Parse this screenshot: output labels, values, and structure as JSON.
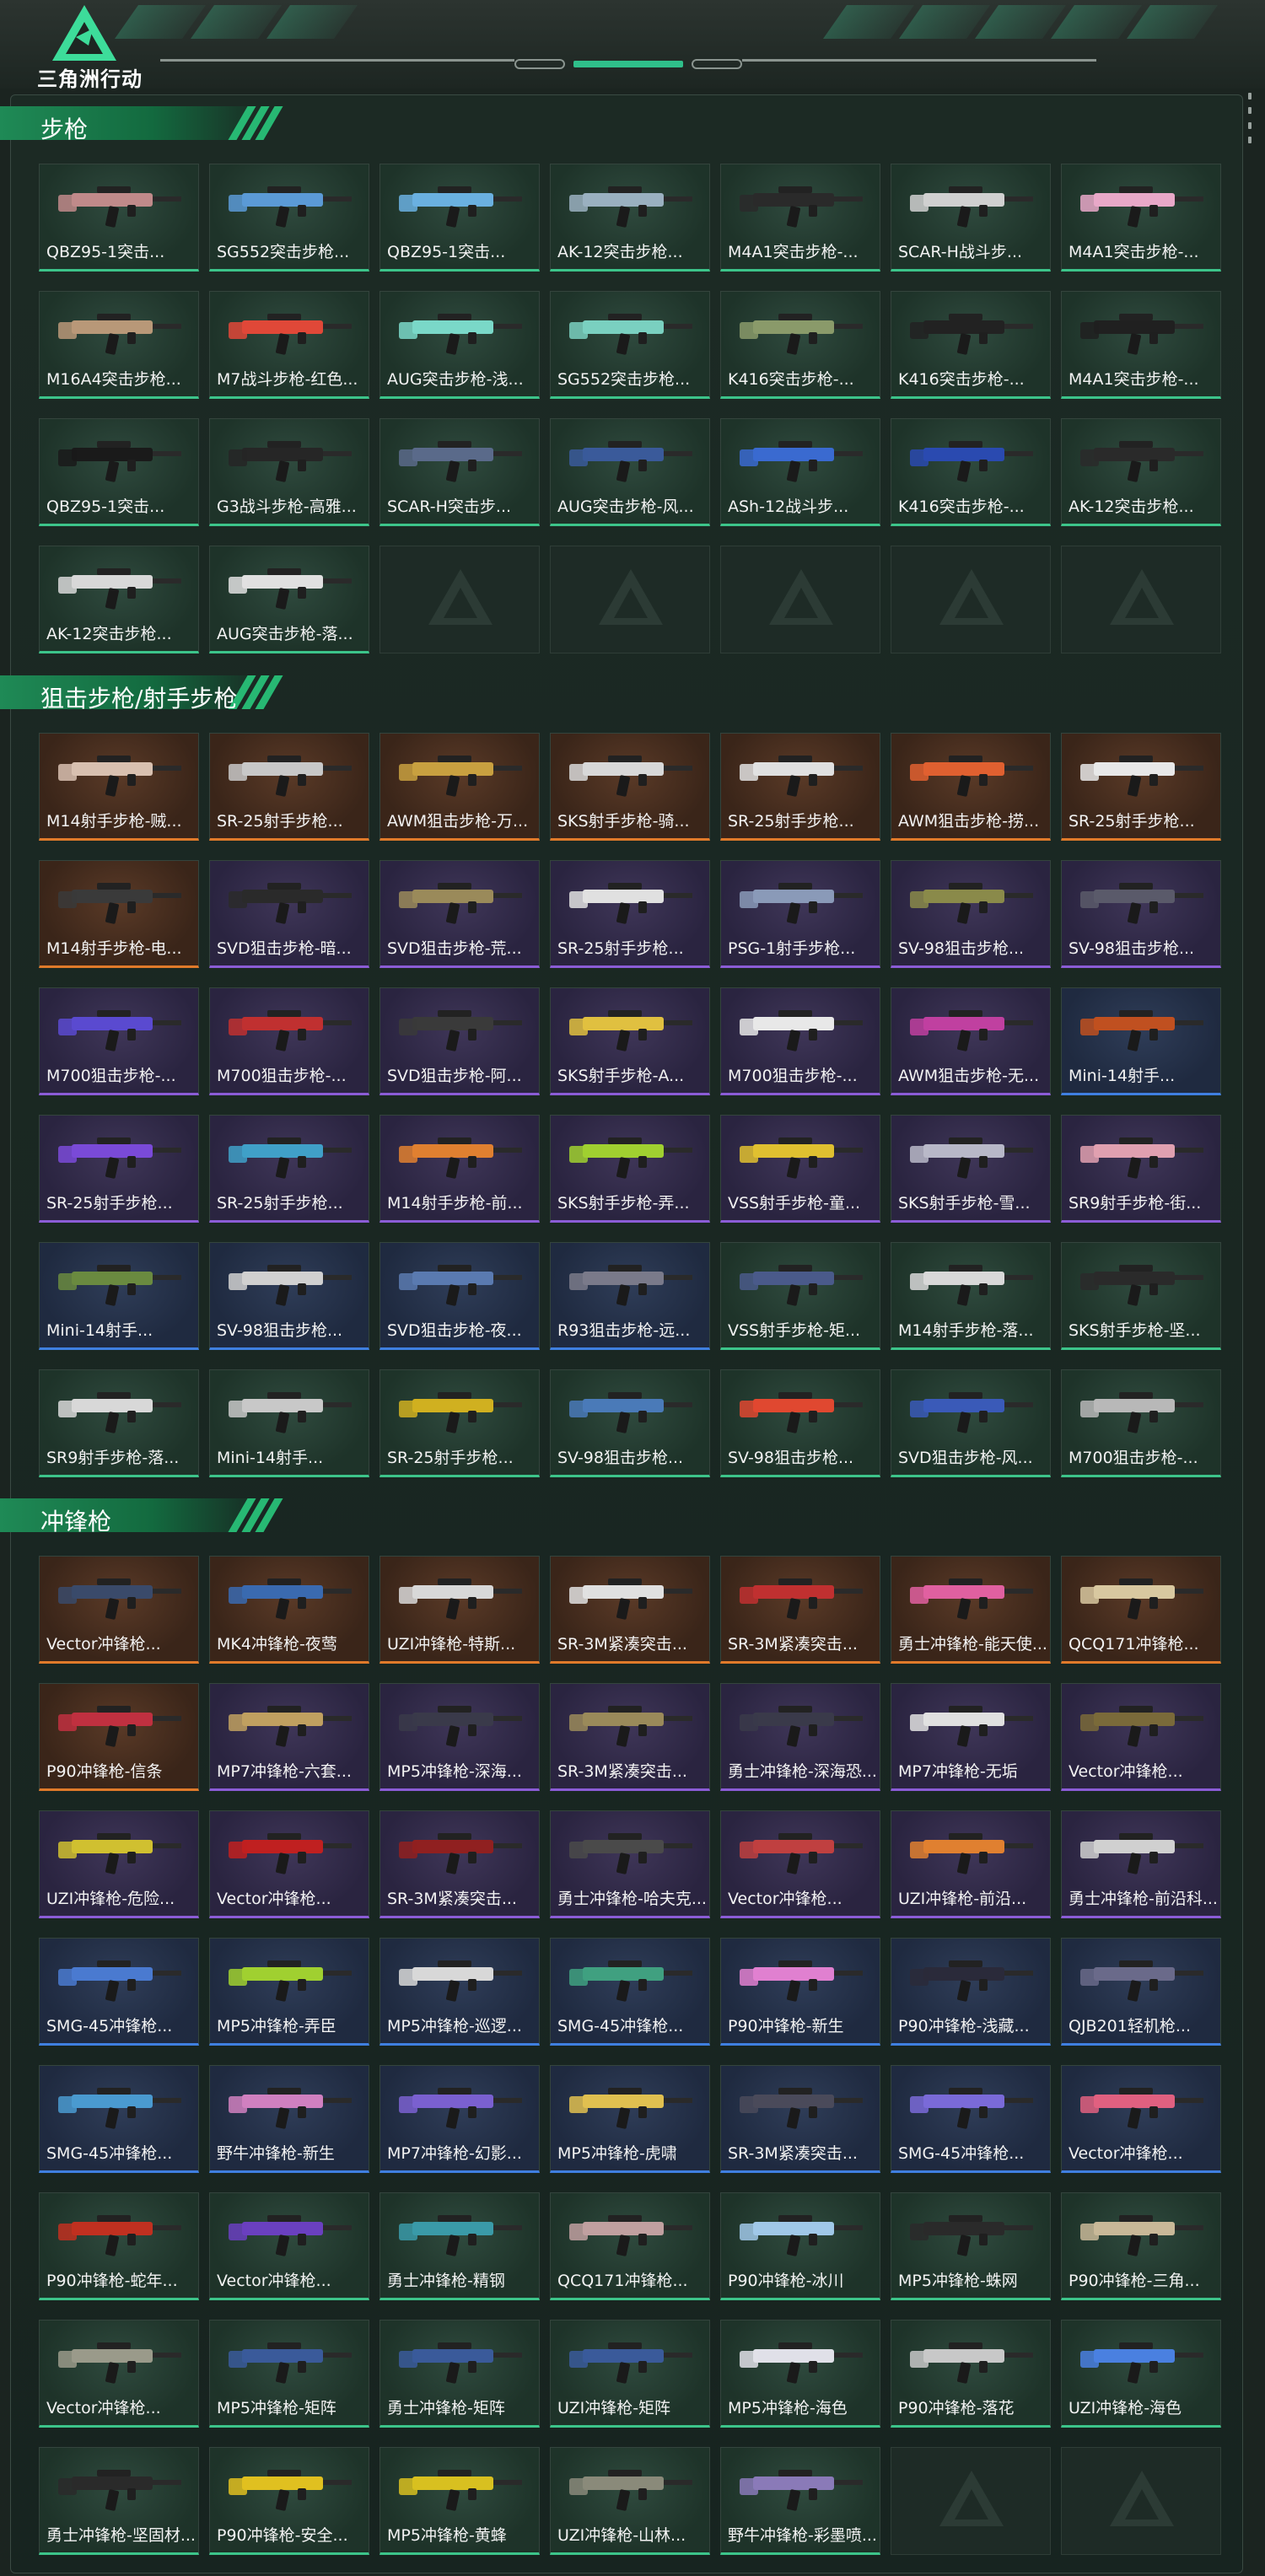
{
  "app": {
    "logo_text": "三角洲行动"
  },
  "sections": [
    {
      "title": "步枪",
      "cards": [
        {
          "label": "QBZ95-1突击...",
          "rarity": "green",
          "color": "#c08a8a"
        },
        {
          "label": "SG552突击步枪...",
          "rarity": "green",
          "color": "#5b9ad6"
        },
        {
          "label": "QBZ95-1突击...",
          "rarity": "green",
          "color": "#6ab0e0"
        },
        {
          "label": "AK-12突击步枪...",
          "rarity": "green",
          "color": "#9ab0c0"
        },
        {
          "label": "M4A1突击步枪-...",
          "rarity": "green",
          "color": "#2a2a2a"
        },
        {
          "label": "SCAR-H战斗步...",
          "rarity": "green",
          "color": "#d0d0d0"
        },
        {
          "label": "M4A1突击步枪-...",
          "rarity": "green",
          "color": "#e8a8c8"
        },
        {
          "label": "M16A4突击步枪...",
          "rarity": "green",
          "color": "#b89878"
        },
        {
          "label": "M7战斗步枪-红色...",
          "rarity": "green",
          "color": "#e04838"
        },
        {
          "label": "AUG突击步枪-浅...",
          "rarity": "green",
          "color": "#7ad8c8"
        },
        {
          "label": "SG552突击步枪...",
          "rarity": "green",
          "color": "#7ad0c0"
        },
        {
          "label": "K416突击步枪-...",
          "rarity": "green",
          "color": "#8a9a6a"
        },
        {
          "label": "K416突击步枪-...",
          "rarity": "green",
          "color": "#222222"
        },
        {
          "label": "M4A1突击步枪-...",
          "rarity": "green",
          "color": "#202020"
        },
        {
          "label": "QBZ95-1突击...",
          "rarity": "green",
          "color": "#1a1a1a"
        },
        {
          "label": "G3战斗步枪-高雅...",
          "rarity": "green",
          "color": "#262626"
        },
        {
          "label": "SCAR-H突击步...",
          "rarity": "green",
          "color": "#5a6a8a"
        },
        {
          "label": "AUG突击步枪-风...",
          "rarity": "green",
          "color": "#3a5a9a"
        },
        {
          "label": "ASh-12战斗步...",
          "rarity": "green",
          "color": "#3a6ad0"
        },
        {
          "label": "K416突击步枪-...",
          "rarity": "green",
          "color": "#2a4ab0"
        },
        {
          "label": "AK-12突击步枪...",
          "rarity": "green",
          "color": "#2a2a2a"
        },
        {
          "label": "AK-12突击步枪...",
          "rarity": "green",
          "color": "#d8d8d8"
        },
        {
          "label": "AUG突击步枪-落...",
          "rarity": "green",
          "color": "#e0e0e0"
        },
        {
          "label": "",
          "rarity": "empty"
        },
        {
          "label": "",
          "rarity": "empty"
        },
        {
          "label": "",
          "rarity": "empty"
        },
        {
          "label": "",
          "rarity": "empty"
        },
        {
          "label": "",
          "rarity": "empty"
        }
      ]
    },
    {
      "title": "狙击步枪/射手步枪",
      "cards": [
        {
          "label": "M14射手步枪-贼...",
          "rarity": "orange",
          "color": "#d8c0b0"
        },
        {
          "label": "SR-25射手步枪...",
          "rarity": "orange",
          "color": "#c8c8c8"
        },
        {
          "label": "AWM狙击步枪-万...",
          "rarity": "orange",
          "color": "#c8a040"
        },
        {
          "label": "SKS射手步枪-骑...",
          "rarity": "orange",
          "color": "#d8d8d8"
        },
        {
          "label": "SR-25射手步枪...",
          "rarity": "orange",
          "color": "#e0e0e0"
        },
        {
          "label": "AWM狙击步枪-捞...",
          "rarity": "orange",
          "color": "#e06030"
        },
        {
          "label": "SR-25射手步枪...",
          "rarity": "orange",
          "color": "#e8e8e8"
        },
        {
          "label": "M14射手步枪-电...",
          "rarity": "orange",
          "color": "#3a3a3a"
        },
        {
          "label": "SVD狙击步枪-暗...",
          "rarity": "purple",
          "color": "#2a2a2a"
        },
        {
          "label": "SVD狙击步枪-荒...",
          "rarity": "purple",
          "color": "#9a8a5a"
        },
        {
          "label": "SR-25射手步枪...",
          "rarity": "purple",
          "color": "#e0e0e0"
        },
        {
          "label": "PSG-1射手步枪...",
          "rarity": "purple",
          "color": "#8a9ab8"
        },
        {
          "label": "SV-98狙击步枪...",
          "rarity": "purple",
          "color": "#8a8a4a"
        },
        {
          "label": "SV-98狙击步枪...",
          "rarity": "purple",
          "color": "#5a5a6a"
        },
        {
          "label": "M700狙击步枪-...",
          "rarity": "purple",
          "color": "#5a4ad0"
        },
        {
          "label": "M700狙击步枪-...",
          "rarity": "purple",
          "color": "#c03030"
        },
        {
          "label": "SVD狙击步枪-阿...",
          "rarity": "purple",
          "color": "#3a3a3a"
        },
        {
          "label": "SKS射手步枪-A...",
          "rarity": "purple",
          "color": "#e0c040"
        },
        {
          "label": "M700狙击步枪-...",
          "rarity": "purple",
          "color": "#e8e8e8"
        },
        {
          "label": "AWM狙击步枪-无...",
          "rarity": "purple",
          "color": "#c040a0"
        },
        {
          "label": "Mini-14射手...",
          "rarity": "blue",
          "color": "#c05020"
        },
        {
          "label": "SR-25射手步枪...",
          "rarity": "purple",
          "color": "#7a4ad8"
        },
        {
          "label": "SR-25射手步枪...",
          "rarity": "purple",
          "color": "#40a0c8"
        },
        {
          "label": "M14射手步枪-前...",
          "rarity": "purple",
          "color": "#e08030"
        },
        {
          "label": "SKS射手步枪-弄...",
          "rarity": "purple",
          "color": "#a0d030"
        },
        {
          "label": "VSS射手步枪-童...",
          "rarity": "purple",
          "color": "#e0c030"
        },
        {
          "label": "SKS射手步枪-雪...",
          "rarity": "purple",
          "color": "#b8b8c8"
        },
        {
          "label": "SR9射手步枪-街...",
          "rarity": "purple",
          "color": "#e0a0b0"
        },
        {
          "label": "Mini-14射手...",
          "rarity": "blue",
          "color": "#6a8a40"
        },
        {
          "label": "SV-98狙击步枪...",
          "rarity": "blue",
          "color": "#d0d0d0"
        },
        {
          "label": "SVD狙击步枪-夜...",
          "rarity": "blue",
          "color": "#5a7ab0"
        },
        {
          "label": "R93狙击步枪-远...",
          "rarity": "blue",
          "color": "#7a7a8a"
        },
        {
          "label": "VSS射手步枪-矩...",
          "rarity": "green",
          "color": "#4a5a8a"
        },
        {
          "label": "M14射手步枪-落...",
          "rarity": "green",
          "color": "#d8d8d8"
        },
        {
          "label": "SKS射手步枪-坚...",
          "rarity": "green",
          "color": "#2a2a2a"
        },
        {
          "label": "SR9射手步枪-落...",
          "rarity": "green",
          "color": "#d8d8d8"
        },
        {
          "label": "Mini-14射手...",
          "rarity": "green",
          "color": "#c8c8c8"
        },
        {
          "label": "SR-25射手步枪...",
          "rarity": "green",
          "color": "#d0b020"
        },
        {
          "label": "SV-98狙击步枪...",
          "rarity": "green",
          "color": "#4a7ab8"
        },
        {
          "label": "SV-98狙击步枪...",
          "rarity": "green",
          "color": "#e04830"
        },
        {
          "label": "SVD狙击步枪-风...",
          "rarity": "green",
          "color": "#3a5ab8"
        },
        {
          "label": "M700狙击步枪-...",
          "rarity": "green",
          "color": "#b8b8b8"
        }
      ]
    },
    {
      "title": "冲锋枪",
      "cards": [
        {
          "label": "Vector冲锋枪...",
          "rarity": "orange",
          "color": "#3a4a6a"
        },
        {
          "label": "MK4冲锋枪-夜莺",
          "rarity": "orange",
          "color": "#3a6ab0"
        },
        {
          "label": "UZI冲锋枪-特斯...",
          "rarity": "orange",
          "color": "#d8d8d8"
        },
        {
          "label": "SR-3M紧凑突击...",
          "rarity": "orange",
          "color": "#e0e0e0"
        },
        {
          "label": "SR-3M紧凑突击...",
          "rarity": "orange",
          "color": "#c03030"
        },
        {
          "label": "勇士冲锋枪-能天使...",
          "rarity": "orange",
          "color": "#e060a0"
        },
        {
          "label": "QCQ171冲锋枪...",
          "rarity": "orange",
          "color": "#d8c8a0"
        },
        {
          "label": "P90冲锋枪-信条",
          "rarity": "orange",
          "color": "#c03040"
        },
        {
          "label": "MP7冲锋枪-六套...",
          "rarity": "purple",
          "color": "#c0a060"
        },
        {
          "label": "MP5冲锋枪-深海...",
          "rarity": "purple",
          "color": "#3a3a4a"
        },
        {
          "label": "SR-3M紧凑突击...",
          "rarity": "purple",
          "color": "#9a8a5a"
        },
        {
          "label": "勇士冲锋枪-深海恐...",
          "rarity": "purple",
          "color": "#3a3a4a"
        },
        {
          "label": "MP7冲锋枪-无垢",
          "rarity": "purple",
          "color": "#e0e0e0"
        },
        {
          "label": "Vector冲锋枪...",
          "rarity": "purple",
          "color": "#7a6a3a"
        },
        {
          "label": "UZI冲锋枪-危险...",
          "rarity": "purple",
          "color": "#d0c030"
        },
        {
          "label": "Vector冲锋枪...",
          "rarity": "purple",
          "color": "#c02020"
        },
        {
          "label": "SR-3M紧凑突击...",
          "rarity": "purple",
          "color": "#902020"
        },
        {
          "label": "勇士冲锋枪-哈夫克...",
          "rarity": "purple",
          "color": "#4a4a4a"
        },
        {
          "label": "Vector冲锋枪...",
          "rarity": "purple",
          "color": "#c04040"
        },
        {
          "label": "UZI冲锋枪-前沿...",
          "rarity": "purple",
          "color": "#e08030"
        },
        {
          "label": "勇士冲锋枪-前沿科...",
          "rarity": "purple",
          "color": "#d0d0d0"
        },
        {
          "label": "SMG-45冲锋枪...",
          "rarity": "blue",
          "color": "#4a7ad0"
        },
        {
          "label": "MP5冲锋枪-弄臣",
          "rarity": "blue",
          "color": "#a0d030"
        },
        {
          "label": "MP5冲锋枪-巡逻...",
          "rarity": "blue",
          "color": "#d8d8d8"
        },
        {
          "label": "SMG-45冲锋枪...",
          "rarity": "blue",
          "color": "#40a080"
        },
        {
          "label": "P90冲锋枪-新生",
          "rarity": "blue",
          "color": "#e080d0"
        },
        {
          "label": "P90冲锋枪-浅藏...",
          "rarity": "blue",
          "color": "#2a2a3a"
        },
        {
          "label": "QJB201轻机枪...",
          "rarity": "blue",
          "color": "#6a6a8a"
        },
        {
          "label": "SMG-45冲锋枪...",
          "rarity": "blue",
          "color": "#4a9ad0"
        },
        {
          "label": "野牛冲锋枪-新生",
          "rarity": "blue",
          "color": "#d080c0"
        },
        {
          "label": "MP7冲锋枪-幻影...",
          "rarity": "blue",
          "color": "#7a60d0"
        },
        {
          "label": "MP5冲锋枪-虎啸",
          "rarity": "blue",
          "color": "#e0c050"
        },
        {
          "label": "SR-3M紧凑突击...",
          "rarity": "blue",
          "color": "#4a4a5a"
        },
        {
          "label": "SMG-45冲锋枪...",
          "rarity": "blue",
          "color": "#7a6ad8"
        },
        {
          "label": "Vector冲锋枪...",
          "rarity": "blue",
          "color": "#e06080"
        },
        {
          "label": "P90冲锋枪-蛇年...",
          "rarity": "green",
          "color": "#c03020"
        },
        {
          "label": "Vector冲锋枪...",
          "rarity": "green",
          "color": "#6a40c0"
        },
        {
          "label": "勇士冲锋枪-精钢",
          "rarity": "green",
          "color": "#3a9aa8"
        },
        {
          "label": "QCQ171冲锋枪...",
          "rarity": "green",
          "color": "#c0a0a0"
        },
        {
          "label": "P90冲锋枪-冰川",
          "rarity": "green",
          "color": "#a0c8e8"
        },
        {
          "label": "MP5冲锋枪-蛛网",
          "rarity": "green",
          "color": "#2a2a2a"
        },
        {
          "label": "P90冲锋枪-三角...",
          "rarity": "green",
          "color": "#c8b898"
        },
        {
          "label": "Vector冲锋枪...",
          "rarity": "green",
          "color": "#9a9a8a"
        },
        {
          "label": "MP5冲锋枪-矩阵",
          "rarity": "green",
          "color": "#3a5a9a"
        },
        {
          "label": "勇士冲锋枪-矩阵",
          "rarity": "green",
          "color": "#3a5a9a"
        },
        {
          "label": "UZI冲锋枪-矩阵",
          "rarity": "green",
          "color": "#3a5a9a"
        },
        {
          "label": "MP5冲锋枪-海色",
          "rarity": "green",
          "color": "#e0e0e8"
        },
        {
          "label": "P90冲锋枪-落花",
          "rarity": "green",
          "color": "#c8c8c8"
        },
        {
          "label": "UZI冲锋枪-海色",
          "rarity": "green",
          "color": "#4a80e0"
        },
        {
          "label": "勇士冲锋枪-坚固材...",
          "rarity": "green",
          "color": "#2a2a2a"
        },
        {
          "label": "P90冲锋枪-安全...",
          "rarity": "green",
          "color": "#e0c020"
        },
        {
          "label": "MP5冲锋枪-黄蜂",
          "rarity": "green",
          "color": "#d8c020"
        },
        {
          "label": "UZI冲锋枪-山林...",
          "rarity": "green",
          "color": "#8a8a7a"
        },
        {
          "label": "野牛冲锋枪-彩墨喷...",
          "rarity": "green",
          "color": "#8a7ab8"
        },
        {
          "label": "",
          "rarity": "empty"
        },
        {
          "label": "",
          "rarity": "empty"
        }
      ]
    }
  ]
}
